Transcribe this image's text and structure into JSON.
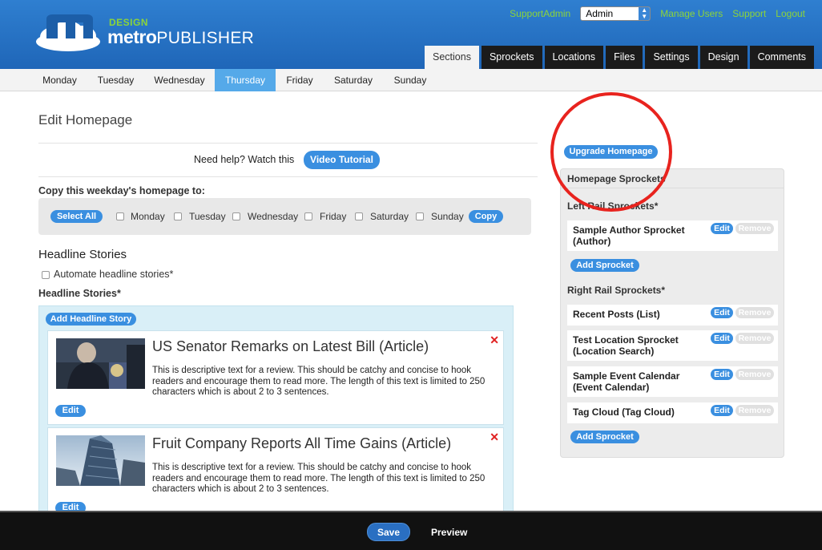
{
  "brand": {
    "design": "DESIGN",
    "name_bold": "metro",
    "name_rest": "PUBLISHER"
  },
  "top_links": {
    "user": "SupportAdmin",
    "account": "Admin",
    "manage_users": "Manage Users",
    "support": "Support",
    "logout": "Logout"
  },
  "main_tabs": [
    "Sections",
    "Sprockets",
    "Locations",
    "Files",
    "Settings",
    "Design",
    "Comments"
  ],
  "active_main_tab": "Sections",
  "day_tabs": [
    "Monday",
    "Tuesday",
    "Wednesday",
    "Thursday",
    "Friday",
    "Saturday",
    "Sunday"
  ],
  "active_day": "Thursday",
  "page": {
    "title": "Edit Homepage",
    "help_text": "Need help? Watch this",
    "video_button": "Video Tutorial"
  },
  "copy": {
    "label": "Copy this weekday's homepage to:",
    "select_all": "Select All",
    "days": [
      "Monday",
      "Tuesday",
      "Wednesday",
      "Friday",
      "Saturday",
      "Sunday"
    ],
    "copy_button": "Copy"
  },
  "headline": {
    "title": "Headline Stories",
    "automate_label": "Automate headline stories*",
    "subtitle": "Headline Stories*",
    "add_button": "Add Headline Story",
    "stories": [
      {
        "title": "US Senator Remarks on Latest Bill (Article)",
        "desc": "This is descriptive text for a review. This should be catchy and concise to hook readers and encourage them to read more. The length of this text is limited to 250 characters which is about 2 to 3 sentences.",
        "edit": "Edit",
        "remove": "✕"
      },
      {
        "title": "Fruit Company Reports All Time Gains (Article)",
        "desc": "This is descriptive text for a review. This should be catchy and concise to hook readers and encourage them to read more. The length of this text is limited to 250 characters which is about 2 to 3 sentences.",
        "edit": "Edit",
        "remove": "✕"
      }
    ]
  },
  "rail": {
    "upgrade_button": "Upgrade Homepage",
    "heading": "Homepage Sprockets",
    "left_title": "Left Rail Sprockets*",
    "left_items": [
      {
        "label": "Sample Author Sprocket (Author)"
      }
    ],
    "right_title": "Right Rail Sprockets*",
    "right_items": [
      {
        "label": "Recent Posts (List)"
      },
      {
        "label": "Test Location Sprocket (Location Search)"
      },
      {
        "label": "Sample Event Calendar (Event Calendar)"
      },
      {
        "label": "Tag Cloud (Tag Cloud)"
      }
    ],
    "edit_label": "Edit",
    "remove_label": "Remove",
    "add_sprocket": "Add Sprocket"
  },
  "footer": {
    "save": "Save",
    "preview": "Preview"
  },
  "colors": {
    "header": "#2f7fd0",
    "accent_green": "#8cd43a",
    "pill_blue": "#3a8fe0",
    "active_day": "#55a9e9",
    "annotation_red": "#e8231e"
  }
}
